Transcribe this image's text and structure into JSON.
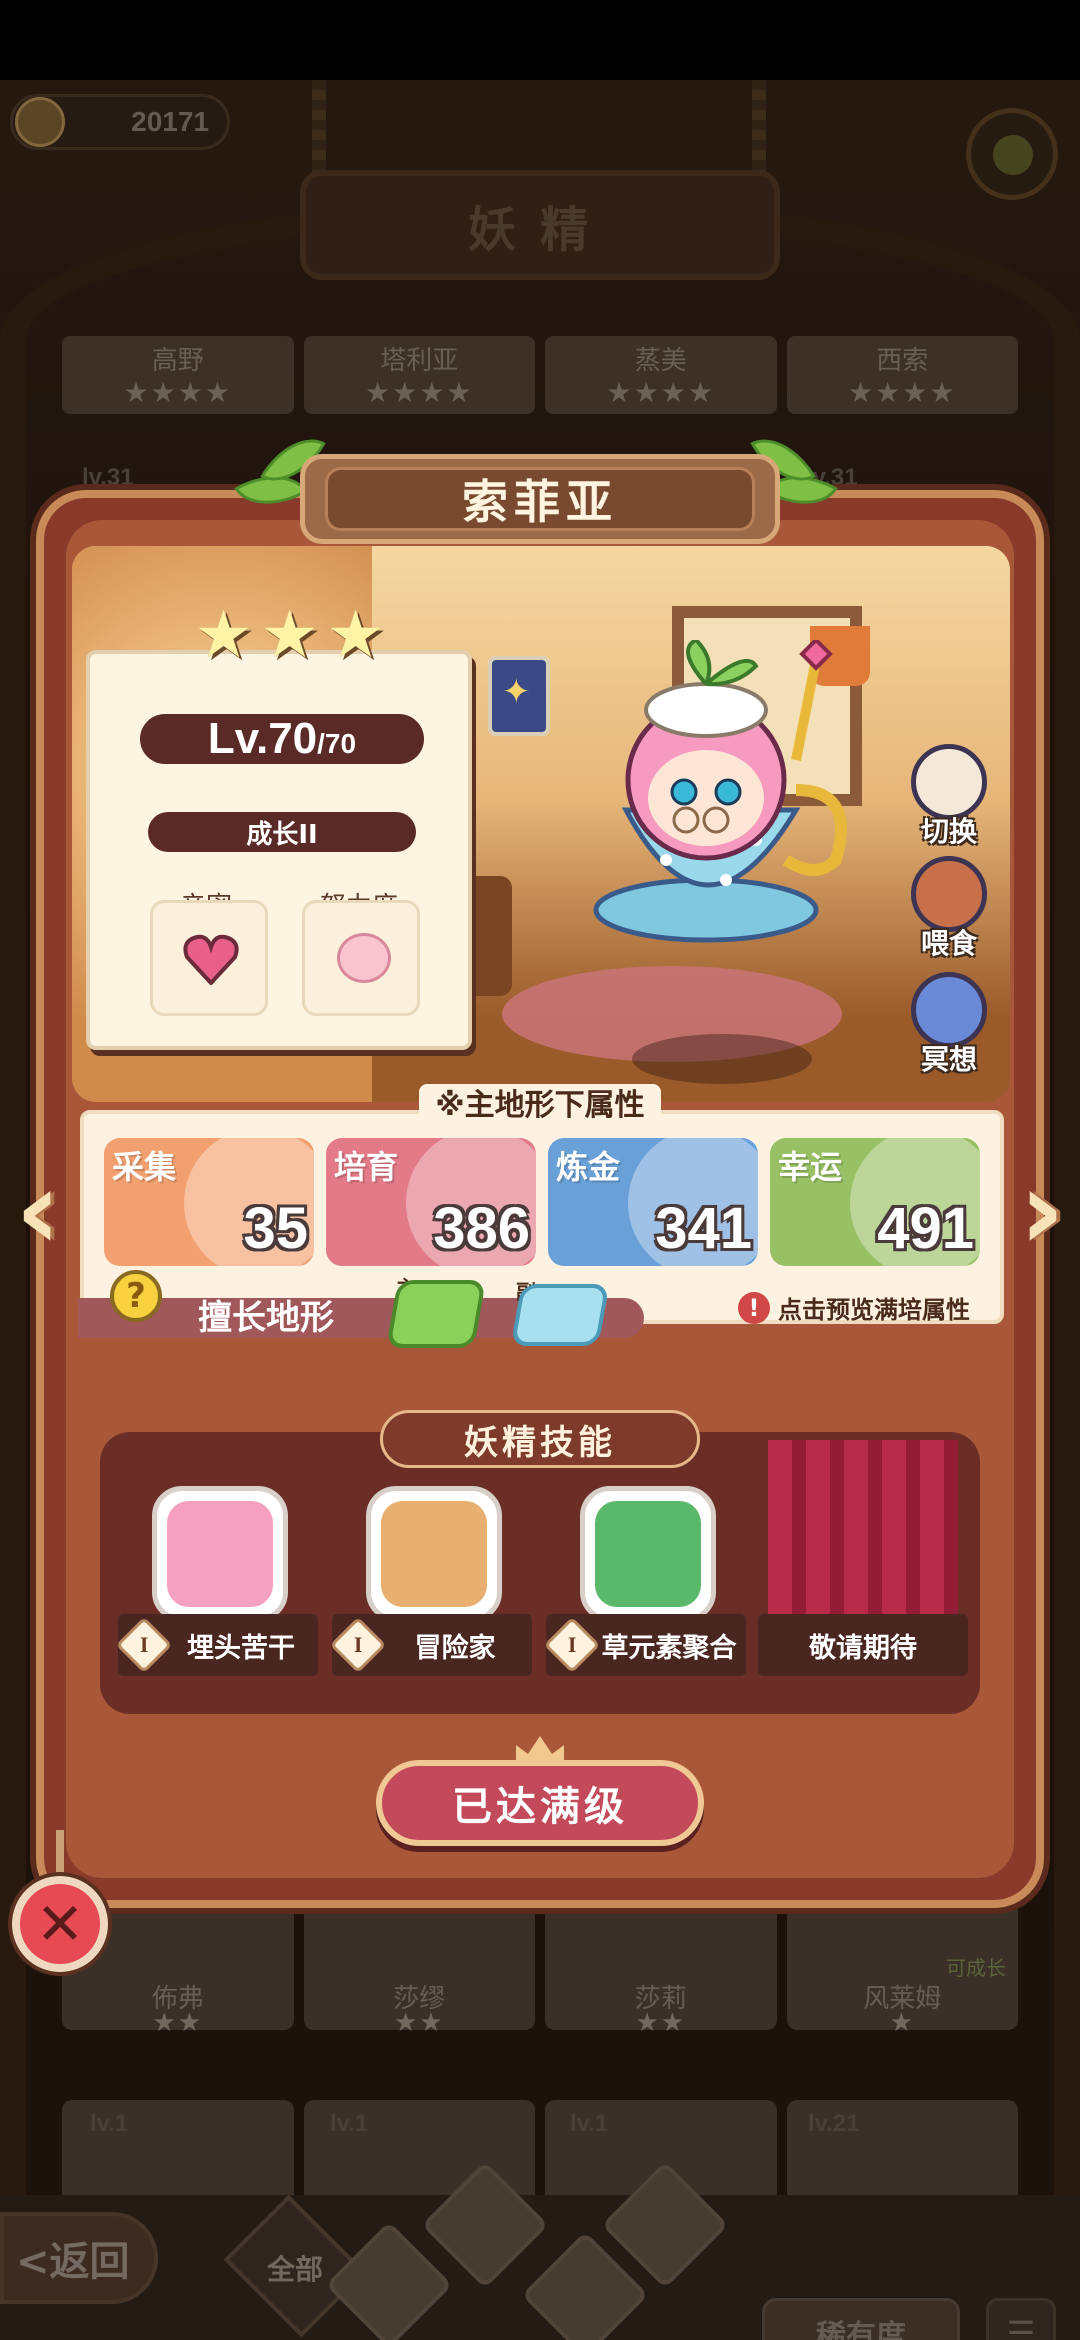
{
  "header": {
    "coins": "20171",
    "title": "妖精"
  },
  "top_cards": [
    {
      "name": "高野",
      "stars": "★★★★"
    },
    {
      "name": "塔利亚",
      "stars": "★★★★"
    },
    {
      "name": "蒸美",
      "stars": "★★★★"
    },
    {
      "name": "西索",
      "stars": "★★★★"
    }
  ],
  "bg_levels": {
    "left": "lv.31",
    "right": "lv.31"
  },
  "bottom_cards": [
    {
      "name": "佈弗",
      "stars": "★★"
    },
    {
      "name": "莎缪",
      "stars": "★★"
    },
    {
      "name": "莎莉",
      "stars": "★★"
    },
    {
      "name": "风莱姆",
      "stars": "★",
      "tag": "可成长"
    }
  ],
  "bottom_levels": [
    "lv.1",
    "lv.1",
    "lv.1",
    "lv.21"
  ],
  "nav": {
    "back_label": "<返回",
    "all_label": "全部",
    "rarity_label": "稀有度",
    "sort_icon": "sort-icon"
  },
  "fairy": {
    "name": "索菲亚",
    "stars": "★★★",
    "level": "Lv.70",
    "level_max": "/70",
    "growth": "成长II",
    "intimacy_label": "亲密",
    "effort_label": "努力度"
  },
  "side_actions": [
    {
      "label": "切换",
      "icon": "switch-icon"
    },
    {
      "label": "喂食",
      "icon": "meat-icon"
    },
    {
      "label": "冥想",
      "icon": "meditate-icon"
    }
  ],
  "attributes": {
    "title": "※主地形下属性",
    "items": [
      {
        "label": "采集",
        "value": "35",
        "color": "#f3a070"
      },
      {
        "label": "培育",
        "value": "386",
        "color": "#e27a88"
      },
      {
        "label": "炼金",
        "value": "341",
        "color": "#6aa0d8"
      },
      {
        "label": "幸运",
        "value": "491",
        "color": "#98c064"
      }
    ],
    "terrain_label": "擅长地形",
    "main_tag": "主",
    "sub_tag": "副",
    "preview_tip": "点击预览满培属性"
  },
  "skills": {
    "title": "妖精技能",
    "items": [
      {
        "name": "埋头苦干",
        "rank": "I"
      },
      {
        "name": "冒险家",
        "rank": "I"
      },
      {
        "name": "草元素聚合",
        "rank": "I"
      }
    ],
    "coming_soon": "敬请期待"
  },
  "max_level_button": "已达满级",
  "close_icon": "close-icon"
}
